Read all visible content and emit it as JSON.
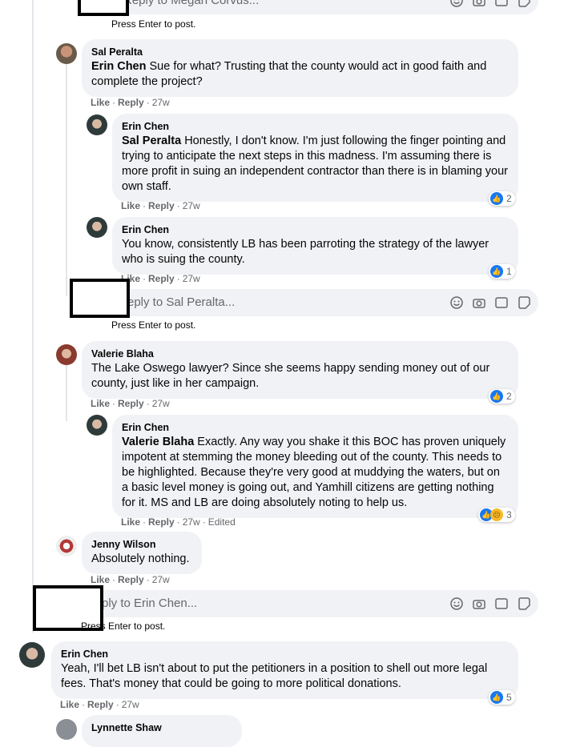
{
  "labels": {
    "like": "Like",
    "reply": "Reply",
    "press_enter": "Press Enter to post."
  },
  "reply_boxes": [
    {
      "placeholder": "Reply to Megan Corvus..."
    },
    {
      "placeholder": "eply to Sal Peralta..."
    },
    {
      "placeholder": "ply to Erin Chen..."
    }
  ],
  "comments": [
    {
      "author": "Sal Peralta",
      "mention": "Erin Chen",
      "text": " Sue for what? Trusting that the county would act in good faith and complete the project?",
      "time": "27w"
    },
    {
      "author": "Erin Chen",
      "mention": "Sal Peralta",
      "text": " Honestly, I don't know. I'm just following the finger pointing and trying to anticipate the next steps in this madness. I'm assuming there is more profit in suing an independent contractor than there is in blaming your own staff.",
      "time": "27w",
      "reactions": "2"
    },
    {
      "author": "Erin Chen",
      "text": "You know, consistently LB has been parroting the strategy of the lawyer who is suing the county.",
      "time": "27w",
      "reactions": "1"
    },
    {
      "author": "Valerie Blaha",
      "text": "The Lake Oswego lawyer? Since she seems happy sending money out of our county, just like in her campaign.",
      "time": "27w",
      "reactions": "2"
    },
    {
      "author": "Erin Chen",
      "mention": "Valerie Blaha",
      "text": " Exactly. Any way you shake it this BOC has proven uniquely impotent at stemming the money bleeding out of the county. This needs to be highlighted. Because they're very good at muddying the waters, but on a basic level money is going out, and Yamhill citizens are getting nothing for it. MS and LB are doing absolutely noting to help us.",
      "time": "27w",
      "edited": "Edited",
      "reactions": "3"
    },
    {
      "author": "Jenny Wilson",
      "text": "Absolutely nothing.",
      "time": "27w"
    },
    {
      "author": "Erin Chen",
      "text": "Yeah, I'll bet LB isn't about to put the petitioners in a position to shell out more legal fees. That's money that could be going to more political donations.",
      "time": "27w",
      "reactions": "5"
    },
    {
      "author": "Lynnette Shaw"
    }
  ],
  "colors": {
    "bubble": "#f0f2f5",
    "meta": "#65676b",
    "like_blue": "#1877f2",
    "sad_yellow": "#f7b928"
  },
  "icons": [
    "emoji-icon",
    "camera-icon",
    "gif-icon",
    "sticker-icon",
    "like-reaction-icon",
    "sad-reaction-icon"
  ]
}
